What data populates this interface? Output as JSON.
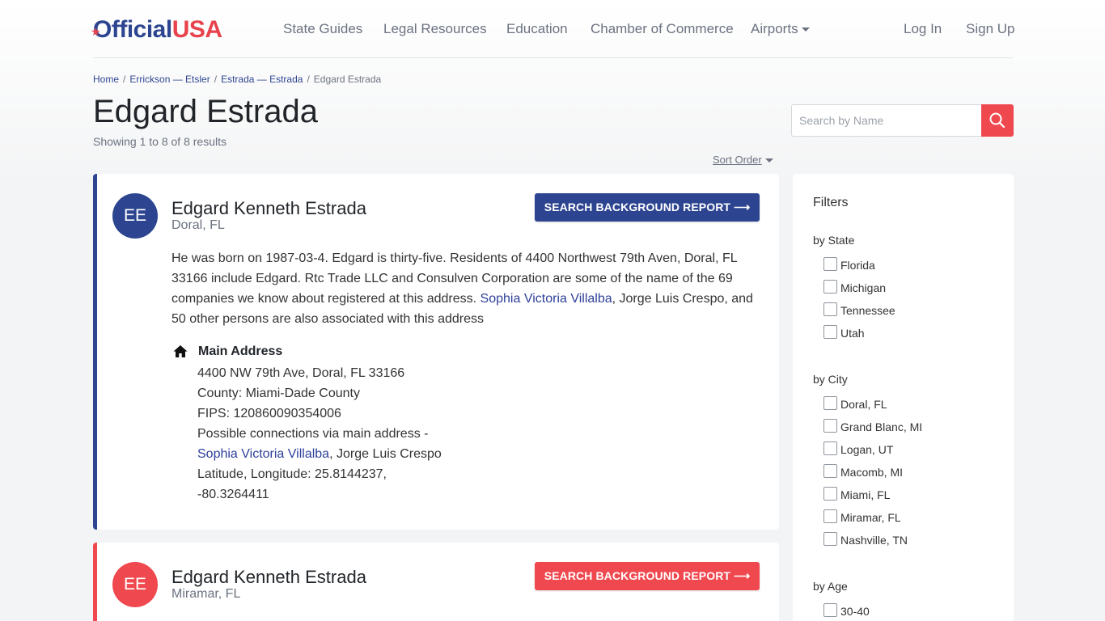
{
  "header": {
    "logo_official": "Official",
    "logo_usa": "USA",
    "nav": [
      "State Guides",
      "Legal Resources",
      "Education",
      "Chamber of Commerce",
      "Airports"
    ],
    "login": "Log In",
    "signup": "Sign Up"
  },
  "breadcrumb": [
    "Home",
    "Errickson — Etsler",
    "Estrada — Estrada",
    "Edgard Estrada"
  ],
  "page": {
    "title": "Edgard Estrada",
    "results": "Showing 1 to 8 of 8 results",
    "sort": "Sort Order"
  },
  "search": {
    "placeholder": "Search by Name"
  },
  "cards": [
    {
      "initials": "EE",
      "name": "Edgard Kenneth Estrada",
      "location": "Doral, FL",
      "button": "SEARCH BACKGROUND REPORT",
      "arrow": "⟶",
      "accent": "#2d4590",
      "bio_1": "He was born on 1987-03-4. Edgard is thirty-five. Residents of 4400 Northwest 79th Aven, Doral, FL 33166 include Edgard. Rtc Trade LLC and Consulven Corporation are some of the name of the 69 companies we know about registered at this address.",
      "bio_link": "Sophia Victoria Villalba",
      "bio_2": ", Jorge Luis Crespo, and 50 other persons are also associated with this address",
      "address_heading": "Main Address",
      "address_line": "4400 NW 79th Ave, Doral, FL 33166",
      "county": "County: Miami-Dade County",
      "fips": "FIPS: 120860090354006",
      "connections": "Possible connections via main address -",
      "conn_link": "Sophia Victoria Villalba",
      "conn_rest": ", Jorge Luis Crespo",
      "latlng_1": "Latitude, Longitude: 25.8144237,",
      "latlng_2": "-80.3264411"
    },
    {
      "initials": "EE",
      "name": "Edgard Kenneth Estrada",
      "location": "Miramar, FL",
      "button": "SEARCH BACKGROUND REPORT",
      "arrow": "⟶",
      "accent": "#f0484f"
    }
  ],
  "filters": {
    "title": "Filters",
    "state_heading": "by State",
    "states": [
      "Florida",
      "Michigan",
      "Tennessee",
      "Utah"
    ],
    "city_heading": "by City",
    "cities": [
      "Doral, FL",
      "Grand Blanc, MI",
      "Logan, UT",
      "Macomb, MI",
      "Miami, FL",
      "Miramar, FL",
      "Nashville, TN"
    ],
    "age_heading": "by Age",
    "ages": [
      "30-40"
    ]
  }
}
